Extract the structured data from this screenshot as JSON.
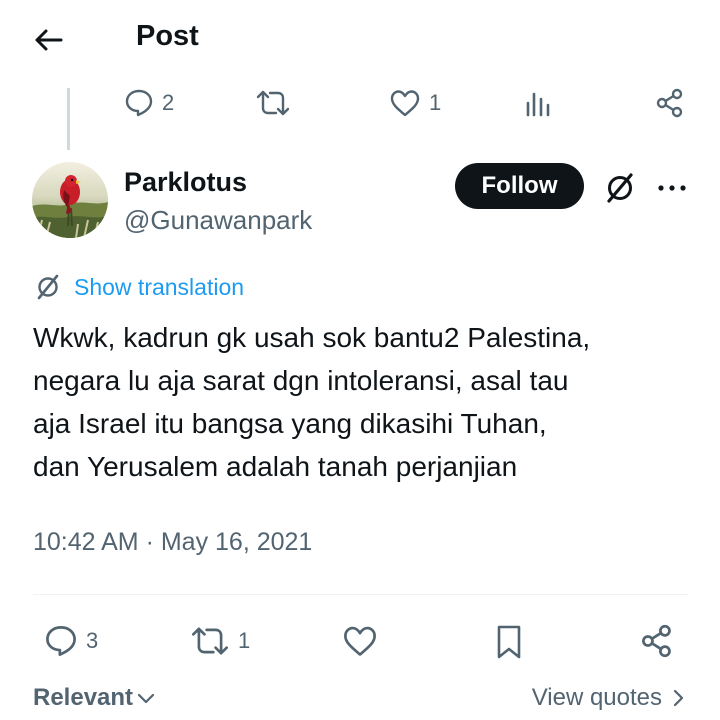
{
  "header": {
    "title": "Post"
  },
  "parent_actions": {
    "reply_count": "2",
    "repost_count": "",
    "like_count": "1"
  },
  "author": {
    "name": "Parklotus",
    "handle": "@Gunawanpark",
    "follow_label": "Follow"
  },
  "translation": {
    "label": "Show translation"
  },
  "tweet": {
    "lines": [
      "Wkwk, kadrun gk usah sok bantu2 Palestina,",
      "negara lu aja sarat dgn intoleransi, asal tau",
      "aja Israel itu bangsa yang dikasihi Tuhan,",
      "dan Yerusalem adalah tanah perjanjian"
    ],
    "timestamp": "10:42 AM · May 16, 2021"
  },
  "actions": {
    "reply_count": "3",
    "repost_count": "1"
  },
  "footer": {
    "sort_label": "Relevant",
    "quotes_label": "View quotes"
  },
  "colors": {
    "text_primary": "#0f1419",
    "text_secondary": "#536471",
    "link": "#1d9bf0",
    "follow_bg": "#0f1419"
  },
  "icons": {
    "back": "arrow-left-icon",
    "reply": "speech-bubble-icon",
    "repost": "repost-arrows-icon",
    "like": "heart-icon",
    "views": "bar-chart-icon",
    "share": "share-nodes-icon",
    "grok": "grok-slash-icon",
    "more": "ellipsis-icon",
    "bookmark": "bookmark-icon",
    "chevron_down": "chevron-down-icon",
    "chevron_right": "chevron-right-icon"
  }
}
